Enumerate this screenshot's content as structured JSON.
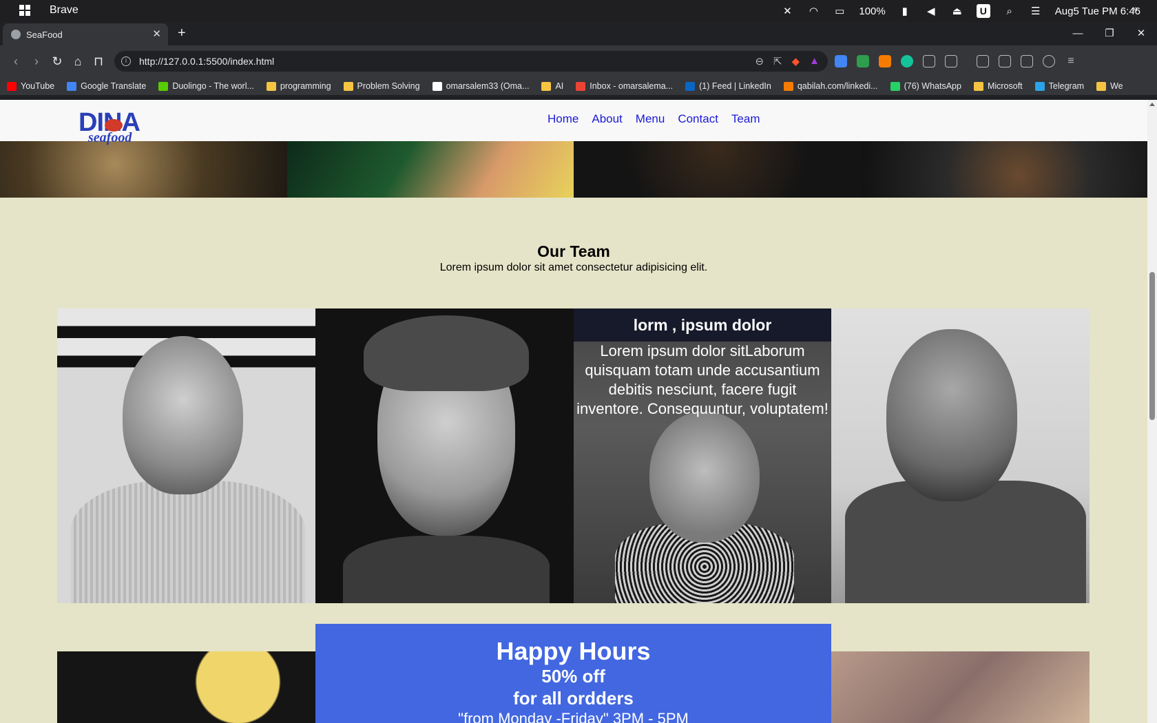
{
  "os": {
    "app_name": "Brave",
    "battery": "100%",
    "date_time": "Aug5 Tue PM 6:46",
    "user_badge": "U"
  },
  "browser": {
    "tab_title": "SeaFood",
    "url": "http://127.0.0.1:5500/index.html",
    "bookmarks": [
      {
        "label": "YouTube",
        "color": "#ff0000"
      },
      {
        "label": "Google Translate",
        "color": "#4285f4"
      },
      {
        "label": "Duolingo - The worl...",
        "color": "#58cc02"
      },
      {
        "label": "programming",
        "color": "#f5c542"
      },
      {
        "label": "Problem Solving",
        "color": "#f5c542"
      },
      {
        "label": "omarsalem33 (Oma...",
        "color": "#ffffff"
      },
      {
        "label": "AI",
        "color": "#f5c542"
      },
      {
        "label": "Inbox - omarsalema...",
        "color": "#ea4335"
      },
      {
        "label": "(1) Feed | LinkedIn",
        "color": "#0a66c2"
      },
      {
        "label": "qabilah.com/linkedi...",
        "color": "#f57c00"
      },
      {
        "label": "(76) WhatsApp",
        "color": "#25d366"
      },
      {
        "label": "Microsoft",
        "color": "#f5c542"
      },
      {
        "label": "Telegram",
        "color": "#2aa3e8"
      },
      {
        "label": "We",
        "color": "#f5c542"
      }
    ]
  },
  "site": {
    "logo_text": "DINA",
    "logo_sub": "seafood",
    "nav": [
      "Home",
      "About",
      "Menu",
      "Contact",
      "Team"
    ],
    "team": {
      "title": "Our Team",
      "subtitle": "Lorem ipsum dolor sit amet consectetur adipisicing elit.",
      "hover_title": "lorm , ipsum dolor",
      "hover_text": "Lorem ipsum dolor sitLaborum quisquam totam unde accusantium debitis nesciunt, facere fugit inventore. Consequuntur, voluptatem!"
    },
    "happy_hours": {
      "title": "Happy Hours",
      "discount": "50% off",
      "scope": "for all ordders",
      "schedule": "\"from Monday -Friday\" 3PM - 5PM"
    }
  },
  "colors": {
    "page_bg": "#e5e4c8",
    "nav_link": "#1a1ad8",
    "happy_bg": "#4267e1",
    "logo_blue": "#2a3fb8"
  }
}
